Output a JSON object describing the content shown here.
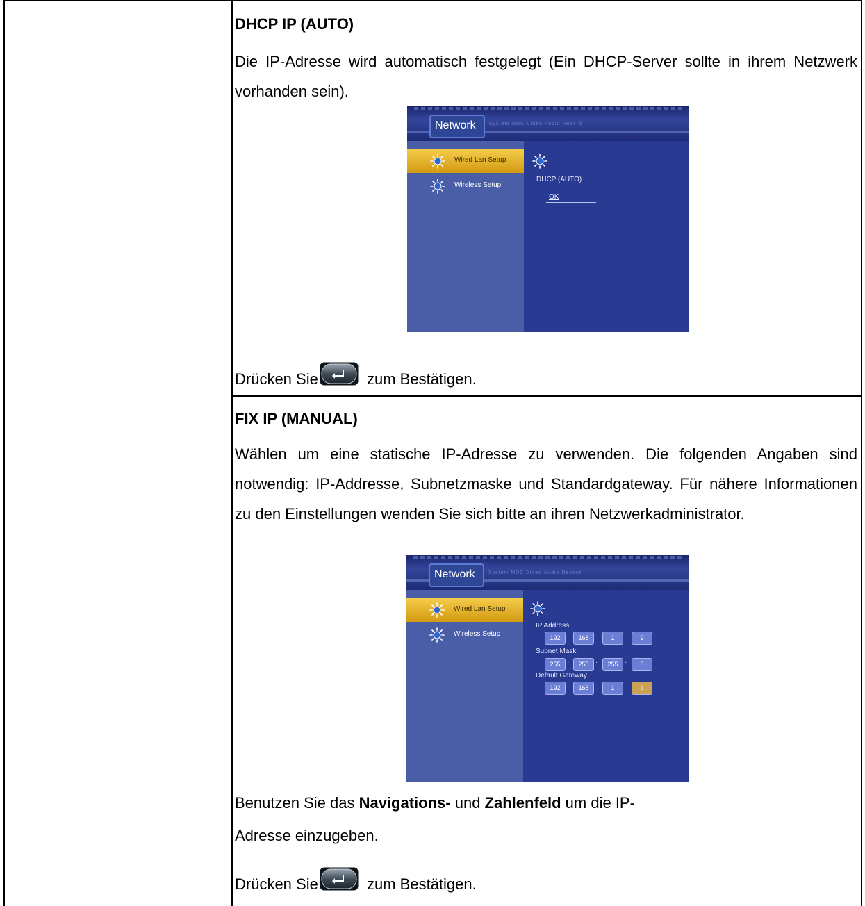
{
  "section1": {
    "title": "DHCP IP (AUTO)",
    "description": "Die IP-Adresse wird automatisch festgelegt (Ein DHCP-Server sollte in ihrem Netzwerk vorhanden sein).",
    "confirm_prefix": "Drücken Sie",
    "confirm_suffix": "zum Bestätigen.",
    "screen": {
      "tab": "Network",
      "other_tabs": "System   MDC   Video   Audio   Record",
      "menu_items": [
        "Wired Lan Setup",
        "Wireless Setup"
      ],
      "mode_label": "DHCP (AUTO)",
      "ok_label": "OK"
    }
  },
  "section2": {
    "title": "FIX IP (MANUAL)",
    "description": "Wählen um eine statische IP-Adresse zu verwenden. Die folgenden Angaben sind notwendig: IP-Addresse, Subnetzmaske und Standardgateway. Für nähere Informationen zu den Einstellungen wenden Sie sich bitte an ihren Netzwerkadministrator.",
    "instruction_1a": "Benutzen Sie das ",
    "instruction_1b": "Navigations-",
    "instruction_1c": " und ",
    "instruction_1d": "Zahlenfeld",
    "instruction_1e": " um die IP-",
    "instruction_2": "Adresse einzugeben.",
    "confirm_prefix": "Drücken Sie",
    "confirm_suffix": "zum Bestätigen.",
    "screen": {
      "tab": "Network",
      "other_tabs": "System   MDC   Video   Audio   Record",
      "menu_items": [
        "Wired Lan Setup",
        "Wireless Setup"
      ],
      "ip_label": "IP Address",
      "ip": [
        "192",
        "168",
        "1",
        "9"
      ],
      "subnet_label": "Subnet Mask",
      "subnet": [
        "255",
        "255",
        "255",
        "0"
      ],
      "gateway_label": "Default Gateway",
      "gateway": [
        "192",
        "168",
        "1",
        "1"
      ]
    }
  },
  "colors": {
    "tv_background": "#22327e",
    "tv_left_panel": "#4a5ea8",
    "tv_selected_item": "#e0ac22",
    "ip_box": "#6a7ed6",
    "ip_box_highlight": "#c9a253"
  },
  "icons": [
    "sun-icon",
    "enter-button-icon"
  ]
}
